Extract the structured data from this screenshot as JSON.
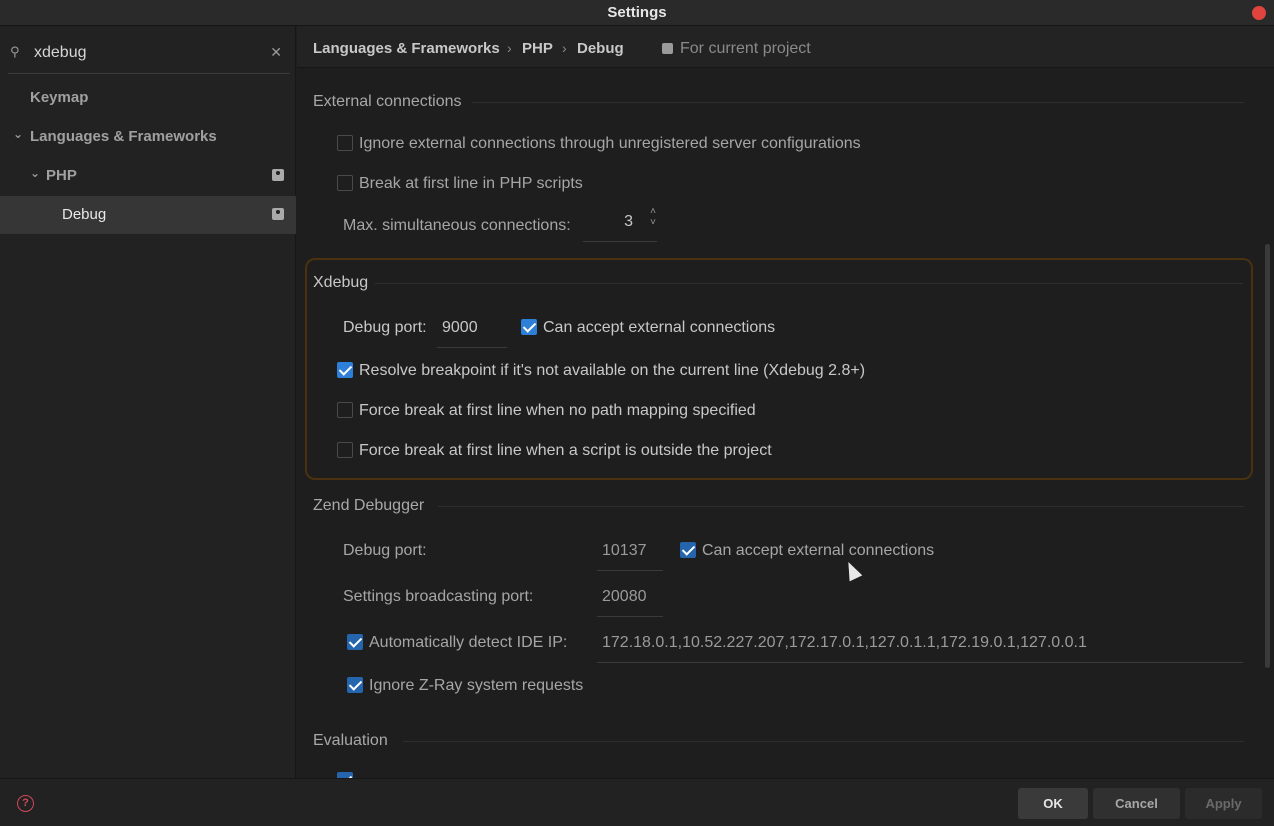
{
  "window": {
    "title": "Settings"
  },
  "sidebar": {
    "search": {
      "value": "xdebug",
      "placeholder": ""
    },
    "items": [
      {
        "label": "Keymap"
      },
      {
        "label": "Languages & Frameworks"
      },
      {
        "label": "PHP"
      },
      {
        "label": "Debug"
      }
    ]
  },
  "breadcrumb": {
    "items": [
      "Languages & Frameworks",
      "PHP",
      "Debug"
    ],
    "separator": "›",
    "scope": "For current project"
  },
  "external": {
    "title": "External connections",
    "ignore_label": "Ignore external connections through unregistered server configurations",
    "ignore_checked": false,
    "break_label": "Break at first line in PHP scripts",
    "break_checked": false,
    "max_label": "Max. simultaneous connections:",
    "max_value": "3"
  },
  "xdebug": {
    "title": "Xdebug",
    "port_label": "Debug port:",
    "port_value": "9000",
    "accept_label": "Can accept external connections",
    "accept_checked": true,
    "resolve_label": "Resolve breakpoint if it's not available on the current line (Xdebug 2.8+)",
    "resolve_checked": true,
    "force_nopath_label": "Force break at first line when no path mapping specified",
    "force_nopath_checked": false,
    "force_outside_label": "Force break at first line when a script is outside the project",
    "force_outside_checked": false
  },
  "zend": {
    "title": "Zend Debugger",
    "port_label": "Debug port:",
    "port_value": "10137",
    "accept_label": "Can accept external connections",
    "accept_checked": true,
    "broadcast_label": "Settings broadcasting port:",
    "broadcast_value": "20080",
    "detect_label": "Automatically detect IDE IP:",
    "detect_checked": true,
    "ip_value": "172.18.0.1,10.52.227.207,172.17.0.1,127.0.1.1,172.19.0.1,127.0.0.1",
    "zray_label": "Ignore Z-Ray system requests",
    "zray_checked": true
  },
  "evaluation": {
    "title": "Evaluation"
  },
  "footer": {
    "ok": "OK",
    "cancel": "Cancel",
    "apply": "Apply"
  },
  "colors": {
    "accent": "#2d7fd8",
    "highlight_border": "#4a3110",
    "close": "#e0443e",
    "help": "#d0485a"
  }
}
